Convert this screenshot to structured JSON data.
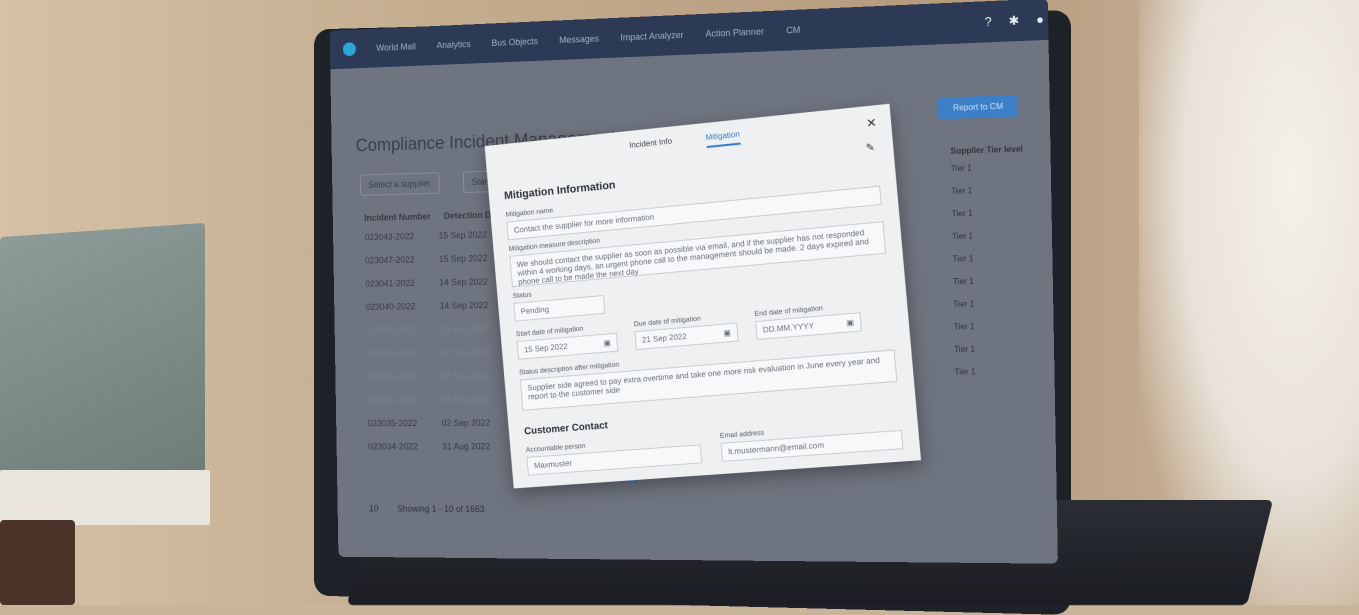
{
  "topbar": {
    "app_name": "World Mall",
    "items": [
      "Analytics",
      "Bus Objects",
      "Messages",
      "Impact Analyzer",
      "Action Planner"
    ],
    "extra": "CM",
    "icons": [
      "help-icon",
      "gear-icon",
      "user-icon"
    ]
  },
  "page": {
    "title": "Compliance Incident Management",
    "report_button": "Report to CM",
    "filter_supplier": "Select a supplier",
    "filter_start": "Start dat"
  },
  "table_left": {
    "headers": [
      "Incident Number",
      "Detection Date"
    ],
    "rows": [
      [
        "023043-2022",
        "15 Sep 2022"
      ],
      [
        "023047-2022",
        "15 Sep 2022"
      ],
      [
        "023041-2022",
        "14 Sep 2022"
      ],
      [
        "023040-2022",
        "14 Sep 2022"
      ],
      [
        "023039-2022",
        "13 Sep 2022"
      ],
      [
        "023038-2022",
        "10 Sep 2022"
      ],
      [
        "023037-2022",
        "08 Sep 2022"
      ],
      [
        "023036-2022",
        "04 Sep 2022"
      ],
      [
        "023035-2022",
        "02 Sep 2022"
      ],
      [
        "023034-2022",
        "31 Aug 2022"
      ]
    ]
  },
  "table_right": {
    "header": "Supplier Tier level",
    "rows": [
      "Tier 1",
      "Tier 1",
      "Tier 1",
      "Tier 1",
      "Tier 1",
      "Tier 1",
      "Tier 1",
      "Tier 1",
      "Tier 1",
      "Tier 1"
    ]
  },
  "pagination": {
    "pages": [
      "1",
      "2",
      "3",
      "4",
      "5",
      "6",
      "7"
    ],
    "page_size": "10",
    "showing": "Showing 1 - 10 of 1663"
  },
  "modal": {
    "tabs": [
      "Incident Info",
      "Mitigation"
    ],
    "active_tab": "Mitigation",
    "section_title": "Mitigation Information",
    "mitigation_name_label": "Mitigation name",
    "mitigation_name_value": "Contact the supplier for more information",
    "description_label": "Mitigation measure description",
    "description_value": "We should contact the supplier as soon as possible via email, and if the supplier has not responded within 4 working days, an urgent phone call to the management should be made. 2 days expired and phone call to be made the next day",
    "status_label": "Status",
    "status_value": "Pending",
    "start_label": "Start date of mitigation",
    "start_value": "15 Sep 2022",
    "due_label": "Due date of mitigation",
    "due_value": "21 Sep 2022",
    "end_label": "End date of mitigation",
    "end_value": "DD.MM.YYYY",
    "status_desc_label": "Status description after mitigation",
    "status_desc_value": "Supplier side agreed to pay extra overtime and take one more risk evaluation in June every year and report to the customer side",
    "contact_title": "Customer Contact",
    "accountable_label": "Accountable person",
    "accountable_value": "Maxmuster",
    "email_label": "Email address",
    "email_value": "lt.mustermann@email.com"
  }
}
